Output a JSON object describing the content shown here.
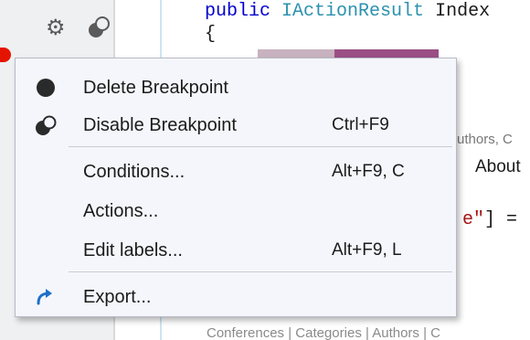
{
  "editor": {
    "code_line_1_keyword": "public",
    "code_line_1_type": "IActionResult",
    "code_line_1_method": "Index",
    "code_line_2": "{",
    "frag_authors": "uthors, C",
    "frag_about": "About",
    "frag_e_string": "e\"",
    "frag_e_rest": "] =",
    "frag_bottom": "Conferences | Categories | Authors | C"
  },
  "context_menu": {
    "items": [
      {
        "label": "Delete Breakpoint",
        "shortcut": "",
        "icon": "breakpoint-filled-icon"
      },
      {
        "label": "Disable Breakpoint",
        "shortcut": "Ctrl+F9",
        "icon": "breakpoint-toggle-icon"
      },
      {
        "label": "Conditions...",
        "shortcut": "Alt+F9, C",
        "icon": ""
      },
      {
        "label": "Actions...",
        "shortcut": "",
        "icon": ""
      },
      {
        "label": "Edit labels...",
        "shortcut": "Alt+F9, L",
        "icon": ""
      },
      {
        "label": "Export...",
        "shortcut": "",
        "icon": "export-arrow-icon"
      }
    ]
  },
  "colors": {
    "breakpoint_red": "#e51400",
    "export_arrow_blue": "#1e6fc8",
    "menu_background": "#f5f6fb"
  }
}
